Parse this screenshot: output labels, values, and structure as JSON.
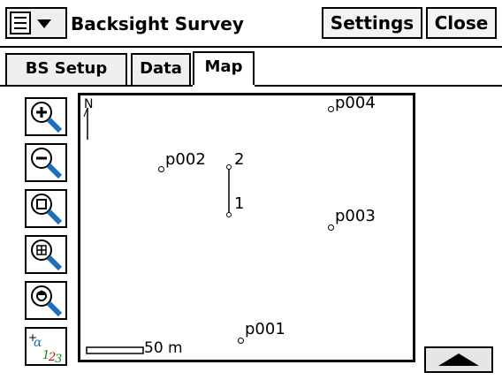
{
  "header": {
    "title": "Backsight Survey",
    "settings_label": "Settings",
    "close_label": "Close"
  },
  "tabs": [
    {
      "label": "BS Setup"
    },
    {
      "label": "Data"
    },
    {
      "label": "Map"
    }
  ],
  "map": {
    "north_label": "N",
    "scale_label": "50 m",
    "points": [
      {
        "label": "p004"
      },
      {
        "label": "p002"
      },
      {
        "label": "2"
      },
      {
        "label": "1"
      },
      {
        "label": "p003"
      },
      {
        "label": "p001"
      }
    ]
  },
  "icons": [
    "zoom-in-icon",
    "zoom-out-icon",
    "zoom-extents-icon",
    "zoom-window-icon",
    "zoom-center-icon",
    "labels-toggle-icon"
  ],
  "colors": {
    "accent_blue": "#1c6fb8",
    "label_green": "#0a8a0a",
    "label_red": "#c00000"
  }
}
